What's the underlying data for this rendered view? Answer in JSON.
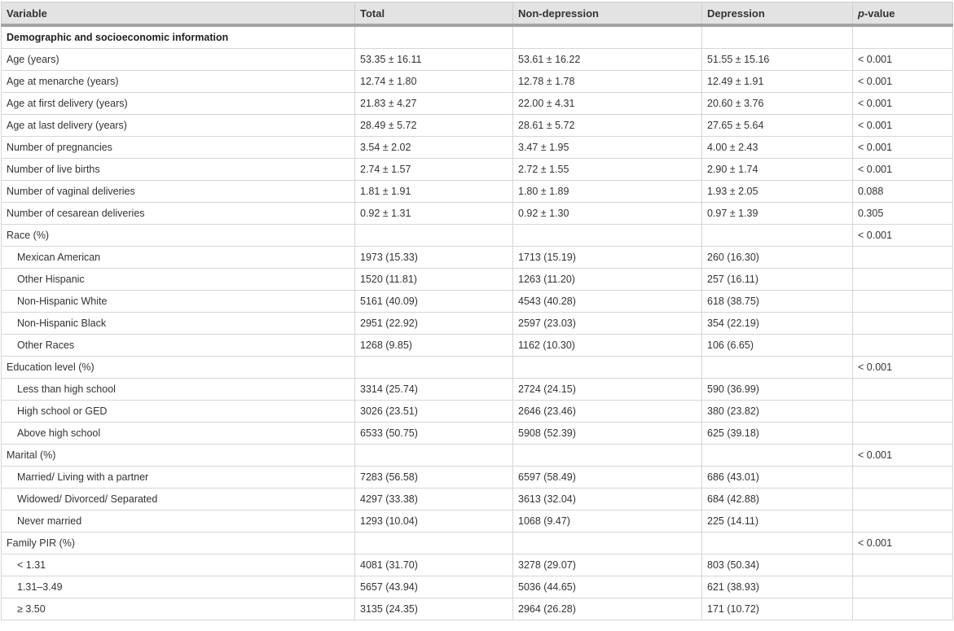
{
  "table": {
    "headers": {
      "variable": "Variable",
      "total": "Total",
      "non_depression": "Non-depression",
      "depression": "Depression",
      "p_italic": "p",
      "p_rest": "-value"
    },
    "section_title": "Demographic and socioeconomic information",
    "rows": [
      {
        "label": "Age (years)",
        "total": "53.35 ± 16.11",
        "nondep": "53.61 ± 16.22",
        "dep": "51.55 ± 15.16",
        "p": "< 0.001"
      },
      {
        "label": "Age at menarche (years)",
        "total": "12.74 ± 1.80",
        "nondep": "12.78 ± 1.78",
        "dep": "12.49 ± 1.91",
        "p": "< 0.001"
      },
      {
        "label": "Age at first delivery (years)",
        "total": "21.83 ± 4.27",
        "nondep": "22.00 ± 4.31",
        "dep": "20.60 ± 3.76",
        "p": "< 0.001"
      },
      {
        "label": "Age at last delivery (years)",
        "total": "28.49 ± 5.72",
        "nondep": "28.61 ± 5.72",
        "dep": "27.65 ± 5.64",
        "p": "< 0.001"
      },
      {
        "label": "Number of pregnancies",
        "total": "3.54 ± 2.02",
        "nondep": "3.47 ± 1.95",
        "dep": "4.00 ± 2.43",
        "p": "< 0.001"
      },
      {
        "label": "Number of live births",
        "total": "2.74 ± 1.57",
        "nondep": "2.72 ± 1.55",
        "dep": "2.90 ± 1.74",
        "p": "< 0.001"
      },
      {
        "label": "Number of vaginal deliveries",
        "total": "1.81 ± 1.91",
        "nondep": "1.80 ± 1.89",
        "dep": "1.93 ± 2.05",
        "p": "0.088"
      },
      {
        "label": "Number of cesarean deliveries",
        "total": "0.92 ± 1.31",
        "nondep": "0.92 ± 1.30",
        "dep": "0.97 ± 1.39",
        "p": "0.305"
      },
      {
        "label": "Race (%)",
        "total": "",
        "nondep": "",
        "dep": "",
        "p": "< 0.001"
      },
      {
        "label": "Mexican American",
        "total": "1973 (15.33)",
        "nondep": "1713 (15.19)",
        "dep": "260 (16.30)",
        "p": ""
      },
      {
        "label": "Other Hispanic",
        "total": "1520 (11.81)",
        "nondep": "1263 (11.20)",
        "dep": "257 (16.11)",
        "p": ""
      },
      {
        "label": "Non-Hispanic White",
        "total": "5161 (40.09)",
        "nondep": "4543 (40.28)",
        "dep": "618 (38.75)",
        "p": ""
      },
      {
        "label": "Non-Hispanic Black",
        "total": "2951 (22.92)",
        "nondep": "2597 (23.03)",
        "dep": "354 (22.19)",
        "p": ""
      },
      {
        "label": "Other Races",
        "total": "1268 (9.85)",
        "nondep": "1162 (10.30)",
        "dep": "106 (6.65)",
        "p": ""
      },
      {
        "label": "Education level (%)",
        "total": "",
        "nondep": "",
        "dep": "",
        "p": "< 0.001"
      },
      {
        "label": "Less than high school",
        "total": "3314 (25.74)",
        "nondep": "2724 (24.15)",
        "dep": "590 (36.99)",
        "p": ""
      },
      {
        "label": "High school or GED",
        "total": "3026 (23.51)",
        "nondep": "2646 (23.46)",
        "dep": "380 (23.82)",
        "p": ""
      },
      {
        "label": "Above high school",
        "total": "6533 (50.75)",
        "nondep": "5908 (52.39)",
        "dep": "625 (39.18)",
        "p": ""
      },
      {
        "label": "Marital (%)",
        "total": "",
        "nondep": "",
        "dep": "",
        "p": "< 0.001"
      },
      {
        "label": "Married/ Living with a partner",
        "total": "7283 (56.58)",
        "nondep": "6597 (58.49)",
        "dep": "686 (43.01)",
        "p": ""
      },
      {
        "label": "Widowed/ Divorced/ Separated",
        "total": "4297 (33.38)",
        "nondep": "3613 (32.04)",
        "dep": "684 (42.88)",
        "p": ""
      },
      {
        "label": "Never married",
        "total": "1293 (10.04)",
        "nondep": "1068 (9.47)",
        "dep": "225 (14.11)",
        "p": ""
      },
      {
        "label": "Family PIR (%)",
        "total": "",
        "nondep": "",
        "dep": "",
        "p": "< 0.001"
      },
      {
        "label": "< 1.31",
        "total": "4081 (31.70)",
        "nondep": "3278 (29.07)",
        "dep": "803 (50.34)",
        "p": ""
      },
      {
        "label": "1.31–3.49",
        "total": "5657 (43.94)",
        "nondep": "5036 (44.65)",
        "dep": "621 (38.93)",
        "p": ""
      },
      {
        "label": "≥ 3.50",
        "total": "3135 (24.35)",
        "nondep": "2964 (26.28)",
        "dep": "171 (10.72)",
        "p": ""
      }
    ]
  }
}
